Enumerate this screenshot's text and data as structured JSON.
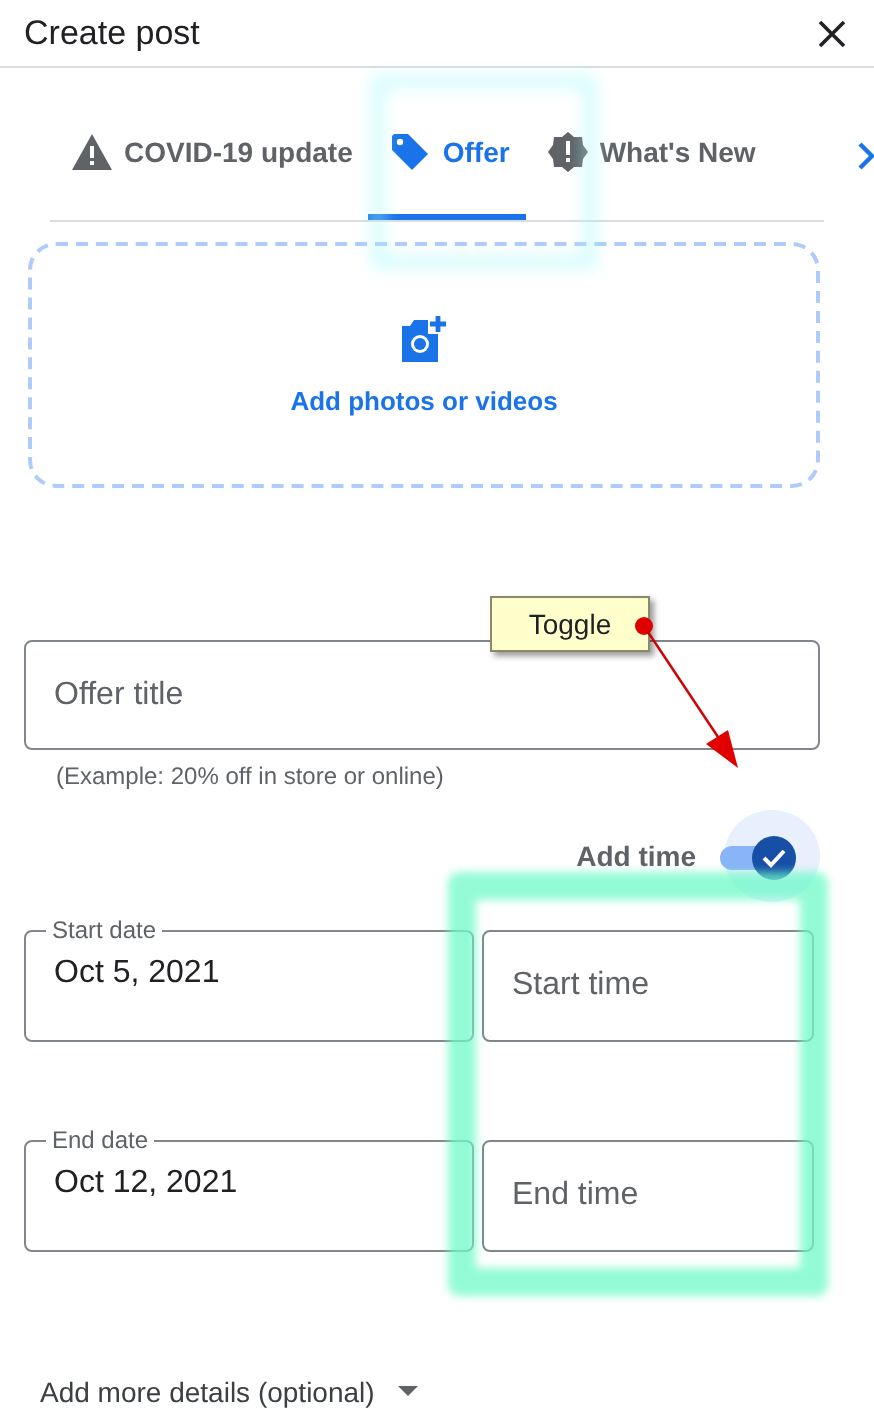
{
  "dialog": {
    "title": "Create post"
  },
  "tabs": [
    {
      "label": "COVID-19 update",
      "kind": "warning",
      "selected": false
    },
    {
      "label": "Offer",
      "kind": "tag",
      "selected": true
    },
    {
      "label": "What's New",
      "kind": "badge",
      "selected": false
    }
  ],
  "upload": {
    "label": "Add photos or videos"
  },
  "offer_title": {
    "placeholder": "Offer title",
    "helper": "(Example: 20% off in store or online)"
  },
  "add_time": {
    "label": "Add time",
    "on": true
  },
  "date_rows": [
    {
      "date_label": "Start date",
      "date_value": "Oct 5, 2021",
      "time_placeholder": "Start time"
    },
    {
      "date_label": "End date",
      "date_value": "Oct 12, 2021",
      "time_placeholder": "End time"
    }
  ],
  "more_details": {
    "label": "Add more details (optional)"
  },
  "annotation": {
    "callout": "Toggle"
  }
}
